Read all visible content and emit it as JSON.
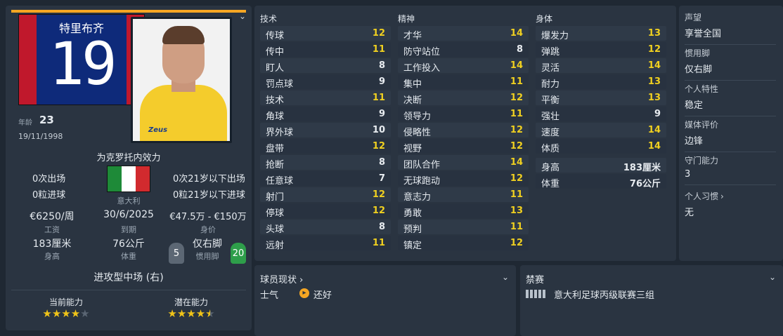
{
  "player": {
    "name": "特里布齐",
    "number": "19",
    "age_label": "年龄",
    "age": "23",
    "dob": "19/11/1998",
    "club_line": "为克罗托内效力",
    "nation": "意大利",
    "caps_left": "0次出场",
    "goals_left": "0粒进球",
    "caps_right": "0次21岁以下出场",
    "goals_right": "0粒21岁以下进球",
    "wage": "€6250/周",
    "wage_label": "工资",
    "expires": "30/6/2025",
    "expires_label": "到期",
    "value": "€47.5万 - €150万",
    "value_label": "身价",
    "height": "183厘米",
    "height_label": "身高",
    "weight": "76公斤",
    "weight_label": "体重",
    "foot": "仅右脚",
    "foot_label": "惯用脚",
    "left_foot_score": "5",
    "right_foot_score": "20",
    "position": "进攻型中场 (右)",
    "current_ability_label": "当前能力",
    "potential_ability_label": "潜在能力",
    "current_ability_stars": 4,
    "potential_ability_stars": 4.5,
    "photo_logo": "Zeus"
  },
  "attributes": {
    "technical": {
      "title": "技术",
      "items": [
        {
          "k": "传球",
          "v": "12"
        },
        {
          "k": "传中",
          "v": "11"
        },
        {
          "k": "盯人",
          "v": "8"
        },
        {
          "k": "罚点球",
          "v": "9"
        },
        {
          "k": "技术",
          "v": "11"
        },
        {
          "k": "角球",
          "v": "9"
        },
        {
          "k": "界外球",
          "v": "10"
        },
        {
          "k": "盘带",
          "v": "12"
        },
        {
          "k": "抢断",
          "v": "8"
        },
        {
          "k": "任意球",
          "v": "7"
        },
        {
          "k": "射门",
          "v": "12"
        },
        {
          "k": "停球",
          "v": "12"
        },
        {
          "k": "头球",
          "v": "8"
        },
        {
          "k": "远射",
          "v": "11"
        }
      ]
    },
    "mental": {
      "title": "精神",
      "items": [
        {
          "k": "才华",
          "v": "14"
        },
        {
          "k": "防守站位",
          "v": "8"
        },
        {
          "k": "工作投入",
          "v": "14"
        },
        {
          "k": "集中",
          "v": "11"
        },
        {
          "k": "决断",
          "v": "12"
        },
        {
          "k": "领导力",
          "v": "11"
        },
        {
          "k": "侵略性",
          "v": "12"
        },
        {
          "k": "视野",
          "v": "12"
        },
        {
          "k": "团队合作",
          "v": "14"
        },
        {
          "k": "无球跑动",
          "v": "12"
        },
        {
          "k": "意志力",
          "v": "11"
        },
        {
          "k": "勇敢",
          "v": "13"
        },
        {
          "k": "预判",
          "v": "11"
        },
        {
          "k": "镇定",
          "v": "12"
        }
      ]
    },
    "physical": {
      "title": "身体",
      "items": [
        {
          "k": "爆发力",
          "v": "13"
        },
        {
          "k": "弹跳",
          "v": "12"
        },
        {
          "k": "灵活",
          "v": "14"
        },
        {
          "k": "耐力",
          "v": "13"
        },
        {
          "k": "平衡",
          "v": "13"
        },
        {
          "k": "强壮",
          "v": "9"
        },
        {
          "k": "速度",
          "v": "14"
        },
        {
          "k": "体质",
          "v": "14"
        }
      ],
      "extra": [
        {
          "k": "身高",
          "v": "183厘米"
        },
        {
          "k": "体重",
          "v": "76公斤"
        }
      ]
    }
  },
  "info": [
    {
      "t": "声望",
      "d": "享誉全国"
    },
    {
      "t": "惯用脚",
      "d": "仅右脚"
    },
    {
      "t": "个人特性",
      "d": "稳定"
    },
    {
      "t": "媒体评价",
      "d": "边锋"
    },
    {
      "t": "守门能力",
      "d": "3"
    },
    {
      "t": "个人习惯",
      "d": "无",
      "arrow": "›"
    }
  ],
  "condition": {
    "title": "球员现状",
    "title_arrow": "›",
    "morale_label": "士气",
    "morale_value": "还好"
  },
  "bans": {
    "title": "禁赛",
    "text": "意大利足球丙级联赛三组"
  },
  "colors": {
    "accent": "#f5a623",
    "highlight_value": "#f0d020",
    "panel": "#2a3441",
    "background": "#1f2833"
  }
}
